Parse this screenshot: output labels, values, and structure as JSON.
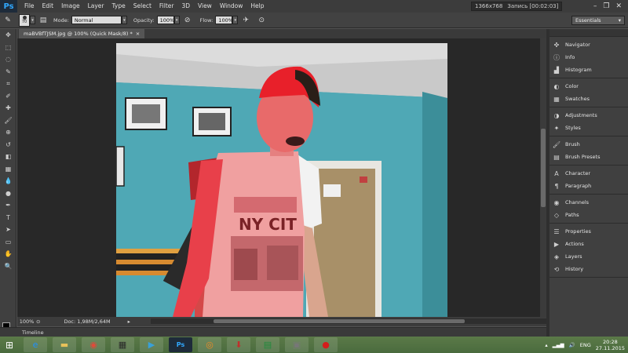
{
  "app": {
    "logo": "Ps",
    "menu": [
      "File",
      "Edit",
      "Image",
      "Layer",
      "Type",
      "Select",
      "Filter",
      "3D",
      "View",
      "Window",
      "Help"
    ],
    "recorder": {
      "resolution": "1366x768",
      "status": "Запись [00:02:03]"
    },
    "window_controls": [
      "–",
      "❐",
      "✕"
    ]
  },
  "options_bar": {
    "brush_size": "70",
    "mode_label": "Mode:",
    "mode_value": "Normal",
    "opacity_label": "Opacity:",
    "opacity_value": "100%",
    "flow_label": "Flow:",
    "flow_value": "100%",
    "workspace": "Essentials"
  },
  "document": {
    "tab_title": "maBVBfTJSM.jpg @ 100% (Quick Mask/8) *",
    "tab_close": "×",
    "zoom": "100%",
    "doc_size": "Doc: 1,98M/2,64M",
    "photo_text": "NY CIT"
  },
  "tools": [
    "move-tool",
    "marquee-tool",
    "lasso-tool",
    "quick-selection-tool",
    "crop-tool",
    "eyedropper-tool",
    "healing-brush-tool",
    "brush-tool",
    "clone-stamp-tool",
    "history-brush-tool",
    "eraser-tool",
    "gradient-tool",
    "blur-tool",
    "dodge-tool",
    "pen-tool",
    "type-tool",
    "path-selection-tool",
    "rectangle-tool",
    "hand-tool",
    "zoom-tool"
  ],
  "tool_glyphs": [
    "✥",
    "⬚",
    "◌",
    "✎",
    "⌗",
    "✐",
    "✚",
    "🖌",
    "⊕",
    "↺",
    "◧",
    "▦",
    "💧",
    "●",
    "✒",
    "T",
    "➤",
    "▭",
    "✋",
    "🔍"
  ],
  "panel": {
    "groups": [
      [
        {
          "label": "Navigator",
          "icon": "navigator-icon",
          "glyph": "✜"
        },
        {
          "label": "Info",
          "icon": "info-icon",
          "glyph": "ⓘ"
        },
        {
          "label": "Histogram",
          "icon": "histogram-icon",
          "glyph": "▟"
        }
      ],
      [
        {
          "label": "Color",
          "icon": "color-icon",
          "glyph": "◐"
        },
        {
          "label": "Swatches",
          "icon": "swatches-icon",
          "glyph": "▦"
        }
      ],
      [
        {
          "label": "Adjustments",
          "icon": "adjustments-icon",
          "glyph": "◑"
        },
        {
          "label": "Styles",
          "icon": "styles-icon",
          "glyph": "✦"
        }
      ],
      [
        {
          "label": "Brush",
          "icon": "brush-icon",
          "glyph": "🖌"
        },
        {
          "label": "Brush Presets",
          "icon": "brush-presets-icon",
          "glyph": "▤"
        }
      ],
      [
        {
          "label": "Character",
          "icon": "character-icon",
          "glyph": "A"
        },
        {
          "label": "Paragraph",
          "icon": "paragraph-icon",
          "glyph": "¶"
        }
      ],
      [
        {
          "label": "Channels",
          "icon": "channels-icon",
          "glyph": "◉"
        },
        {
          "label": "Paths",
          "icon": "paths-icon",
          "glyph": "◇"
        }
      ],
      [
        {
          "label": "Properties",
          "icon": "properties-icon",
          "glyph": "☰"
        },
        {
          "label": "Actions",
          "icon": "actions-icon",
          "glyph": "▶"
        },
        {
          "label": "Layers",
          "icon": "layers-icon",
          "glyph": "◈"
        },
        {
          "label": "History",
          "icon": "history-icon",
          "glyph": "⟲"
        }
      ]
    ]
  },
  "timeline_label": "Timeline",
  "taskbar": {
    "apps": [
      {
        "name": "ie-icon",
        "glyph": "e",
        "color": "#1e90ff"
      },
      {
        "name": "explorer-icon",
        "glyph": "▬",
        "color": "#e8c15a"
      },
      {
        "name": "chrome-icon",
        "glyph": "◉",
        "color": "#e04a3a"
      },
      {
        "name": "media-icon",
        "glyph": "▦",
        "color": "#2a2a2a"
      },
      {
        "name": "player-icon",
        "glyph": "▶",
        "color": "#3aa0d8"
      },
      {
        "name": "photoshop-icon",
        "glyph": "Ps",
        "color": "#1e2b3a"
      },
      {
        "name": "aimp-icon",
        "glyph": "◎",
        "color": "#f08a24"
      },
      {
        "name": "downloader-icon",
        "glyph": "⬇",
        "color": "#c0302c"
      },
      {
        "name": "excel-icon",
        "glyph": "▤",
        "color": "#1f8a3c"
      },
      {
        "name": "gallery-icon",
        "glyph": "▣",
        "color": "#777777"
      },
      {
        "name": "recorder-icon",
        "glyph": "●",
        "color": "#d41c1c"
      }
    ],
    "lang": "ENG",
    "time": "20:28",
    "date": "27.11.2015"
  }
}
